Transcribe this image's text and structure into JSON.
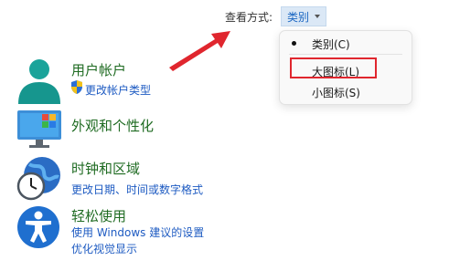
{
  "view_by": {
    "label": "查看方式:",
    "selected": "类别",
    "options": [
      {
        "label": "类别(C)",
        "checked": true
      },
      {
        "label": "大图标(L)",
        "checked": false
      },
      {
        "label": "小图标(S)",
        "checked": false
      }
    ]
  },
  "categories": [
    {
      "title": "用户帐户",
      "links": [
        "更改帐户类型"
      ],
      "icon": "user-icon",
      "link_icon": "shield-icon"
    },
    {
      "title": "外观和个性化",
      "links": [],
      "icon": "monitor-personalize-icon"
    },
    {
      "title": "时钟和区域",
      "links": [
        "更改日期、时间或数字格式"
      ],
      "icon": "clock-globe-icon"
    },
    {
      "title": "轻松使用",
      "links": [
        "使用 Windows 建议的设置",
        "优化视觉显示"
      ],
      "icon": "accessibility-icon"
    }
  ],
  "colors": {
    "accent": "#1a66c2",
    "category_title": "#1f6b22",
    "link": "#1e5bc2",
    "highlight_box": "#e0262e",
    "arrow": "#e0262e"
  }
}
